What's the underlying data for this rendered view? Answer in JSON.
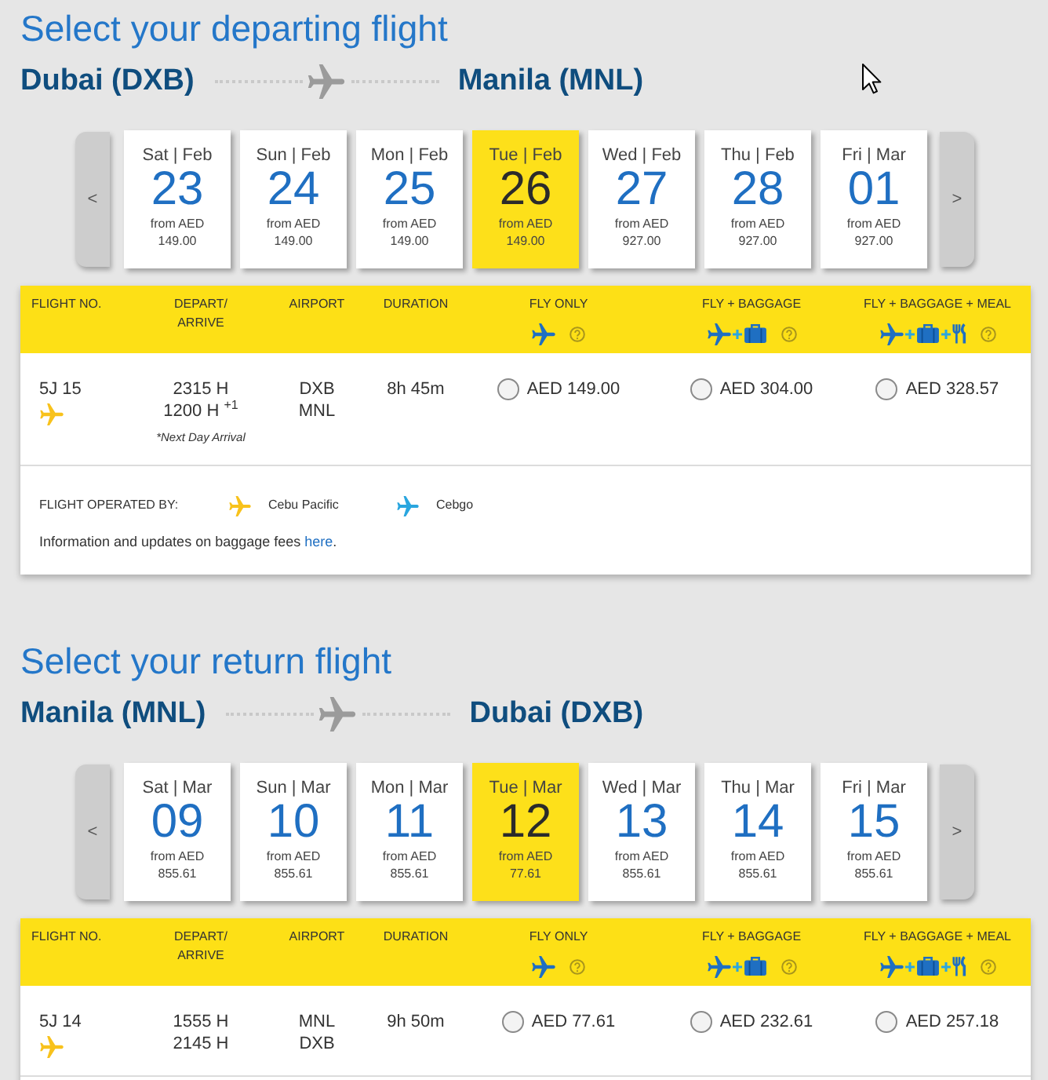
{
  "sections": [
    {
      "title": "Select your departing flight",
      "route": {
        "origin": "Dubai (DXB)",
        "destination": "Manila (MNL)"
      },
      "date_picker": {
        "prev": "<",
        "next": ">",
        "days": [
          {
            "label": "Sat | Feb",
            "day": "23",
            "caption": "from AED",
            "price": "149.00",
            "selected": false
          },
          {
            "label": "Sun | Feb",
            "day": "24",
            "caption": "from AED",
            "price": "149.00",
            "selected": false
          },
          {
            "label": "Mon | Feb",
            "day": "25",
            "caption": "from AED",
            "price": "149.00",
            "selected": false
          },
          {
            "label": "Tue | Feb",
            "day": "26",
            "caption": "from AED",
            "price": "149.00",
            "selected": true
          },
          {
            "label": "Wed | Feb",
            "day": "27",
            "caption": "from AED",
            "price": "927.00",
            "selected": false
          },
          {
            "label": "Thu | Feb",
            "day": "28",
            "caption": "from AED",
            "price": "927.00",
            "selected": false
          },
          {
            "label": "Fri | Mar",
            "day": "01",
            "caption": "from AED",
            "price": "927.00",
            "selected": false
          }
        ]
      },
      "table": {
        "columns": [
          {
            "kind": "text",
            "label": "FLIGHT NO."
          },
          {
            "kind": "text",
            "label": "DEPART/\nARRIVE"
          },
          {
            "kind": "text",
            "label": "AIRPORT"
          },
          {
            "kind": "text",
            "label": "DURATION"
          },
          {
            "kind": "fly",
            "label": "FLY ONLY"
          },
          {
            "kind": "fly_baggage",
            "label": "FLY + BAGGAGE"
          },
          {
            "kind": "fly_baggage_meal",
            "label": "FLY + BAGGAGE + MEAL"
          }
        ],
        "rows": [
          {
            "flight_no": "5J 15",
            "color": "#f8c21c",
            "depart": "2315 H",
            "arrive": "1200 H $^{+1}$",
            "note": "*Next Day Arrival",
            "airports": [
              "DXB",
              "MNL"
            ],
            "duration": "8h 45m",
            "fares": [
              {
                "price": "AED 149.00",
                "selected": false
              },
              {
                "price": "AED 304.00",
                "selected": false
              },
              {
                "price": "AED 328.57",
                "selected": false
              }
            ]
          }
        ],
        "footer": {
          "label": "FLIGHT OPERATED BY:",
          "operators": [
            {
              "name": "Cebu Pacific",
              "color": "#f8c21c"
            },
            {
              "name": "Cebgo",
              "color": "#2aa6df"
            }
          ],
          "info": "Information and updates on baggage fees ",
          "link": "here",
          "info_end": "."
        }
      }
    },
    {
      "title": "Select your return flight",
      "route": {
        "origin": "Manila (MNL)",
        "destination": "Dubai (DXB)"
      },
      "date_picker": {
        "prev": "<",
        "next": ">",
        "days": [
          {
            "label": "Sat | Mar",
            "day": "09",
            "caption": "from AED",
            "price": "855.61",
            "selected": false
          },
          {
            "label": "Sun | Mar",
            "day": "10",
            "caption": "from AED",
            "price": "855.61",
            "selected": false
          },
          {
            "label": "Mon | Mar",
            "day": "11",
            "caption": "from AED",
            "price": "855.61",
            "selected": false
          },
          {
            "label": "Tue | Mar",
            "day": "12",
            "caption": "from AED",
            "price": "77.61",
            "selected": true
          },
          {
            "label": "Wed | Mar",
            "day": "13",
            "caption": "from AED",
            "price": "855.61",
            "selected": false
          },
          {
            "label": "Thu | Mar",
            "day": "14",
            "caption": "from AED",
            "price": "855.61",
            "selected": false
          },
          {
            "label": "Fri | Mar",
            "day": "15",
            "caption": "from AED",
            "price": "855.61",
            "selected": false
          }
        ]
      },
      "table": {
        "columns": [
          {
            "kind": "text",
            "label": "FLIGHT NO."
          },
          {
            "kind": "text",
            "label": "DEPART/\nARRIVE"
          },
          {
            "kind": "text",
            "label": "AIRPORT"
          },
          {
            "kind": "text",
            "label": "DURATION"
          },
          {
            "kind": "fly",
            "label": "FLY ONLY"
          },
          {
            "kind": "fly_baggage",
            "label": "FLY + BAGGAGE"
          },
          {
            "kind": "fly_baggage_meal",
            "label": "FLY + BAGGAGE + MEAL"
          }
        ],
        "rows": [
          {
            "flight_no": "5J 14",
            "color": "#f8c21c",
            "depart": "1555 H",
            "arrive": "2145 H",
            "airports": [
              "MNL",
              "DXB"
            ],
            "duration": "9h 50m",
            "fares": [
              {
                "price": "AED 77.61",
                "selected": false
              },
              {
                "price": "AED 232.61",
                "selected": false
              },
              {
                "price": "AED 257.18",
                "selected": false
              }
            ]
          }
        ]
      }
    }
  ]
}
